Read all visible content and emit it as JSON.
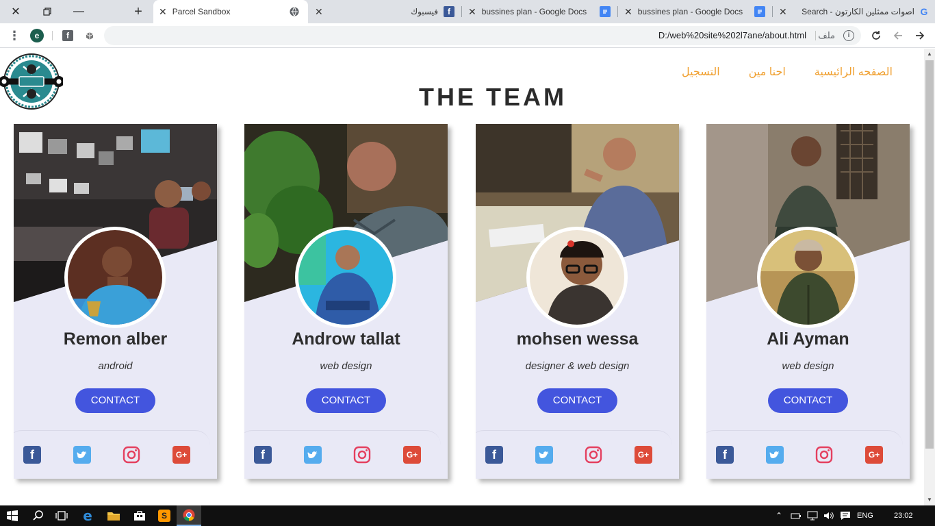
{
  "window": {
    "tabs": [
      {
        "title": "Parcel Sandbox",
        "active": true
      },
      {
        "title": "فيسبوك"
      },
      {
        "title": "bussines plan - Google Docs"
      },
      {
        "title": "bussines plan - Google Docs"
      },
      {
        "title": "اصوات ممثلين الكارتون - Search"
      }
    ],
    "address": {
      "url": "D:/web%20site%202l7ane/about.html",
      "scheme_label": "ملف"
    }
  },
  "page": {
    "nav": [
      "الصفحه الرائيسية",
      "احنا مين",
      "التسجيل"
    ],
    "title": "THE TEAM",
    "members": [
      {
        "name": "Remon alber",
        "role": "android",
        "button": "CONTACT"
      },
      {
        "name": "Androw tallat",
        "role": "web design",
        "button": "CONTACT"
      },
      {
        "name": "mohsen wessa",
        "role": "designer & web design",
        "button": "CONTACT"
      },
      {
        "name": "Ali Ayman",
        "role": "web design",
        "button": "CONTACT"
      }
    ],
    "social_icons": [
      "facebook-icon",
      "twitter-icon",
      "instagram-icon",
      "google-plus-icon"
    ],
    "colors": {
      "nav": "#f0a030",
      "button": "#4355de",
      "card_bg": "#e9e9f6",
      "facebook": "#3b5998",
      "twitter": "#55acee",
      "instagram": "#e4405f",
      "google_plus": "#dd4b39"
    }
  },
  "taskbar": {
    "language": "ENG",
    "time": "23:02"
  }
}
